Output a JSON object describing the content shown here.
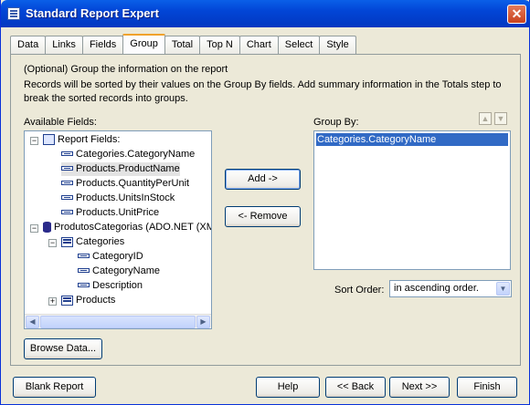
{
  "window": {
    "title": "Standard Report Expert",
    "close_glyph": "✕"
  },
  "tabs": [
    {
      "label": "Data"
    },
    {
      "label": "Links"
    },
    {
      "label": "Fields"
    },
    {
      "label": "Group",
      "active": true
    },
    {
      "label": "Total"
    },
    {
      "label": "Top N"
    },
    {
      "label": "Chart"
    },
    {
      "label": "Select"
    },
    {
      "label": "Style"
    }
  ],
  "description": {
    "line1": "(Optional)  Group the information on the report",
    "line2": "Records will be sorted by their values on the Group By fields.  Add summary information in the Totals step to break the sorted records into groups."
  },
  "available_fields": {
    "label": "Available Fields:",
    "report_fields_label": "Report Fields:",
    "report_fields": [
      "Categories.CategoryName",
      "Products.ProductName",
      "Products.QuantityPerUnit",
      "Products.UnitsInStock",
      "Products.UnitPrice"
    ],
    "datasource_label": "ProdutosCategorias (ADO.NET (XML))",
    "categories_label": "Categories",
    "category_fields": [
      "CategoryID",
      "CategoryName",
      "Description"
    ],
    "products_label": "Products"
  },
  "buttons": {
    "add": "Add ->",
    "remove": "<- Remove",
    "browse": "Browse Data...",
    "blank_report": "Blank Report",
    "help": "Help",
    "back": "<< Back",
    "next": "Next >>",
    "finish": "Finish"
  },
  "group_by": {
    "label": "Group By:",
    "items": [
      "Categories.CategoryName"
    ]
  },
  "sort_order": {
    "label": "Sort Order:",
    "value": "in ascending order."
  }
}
